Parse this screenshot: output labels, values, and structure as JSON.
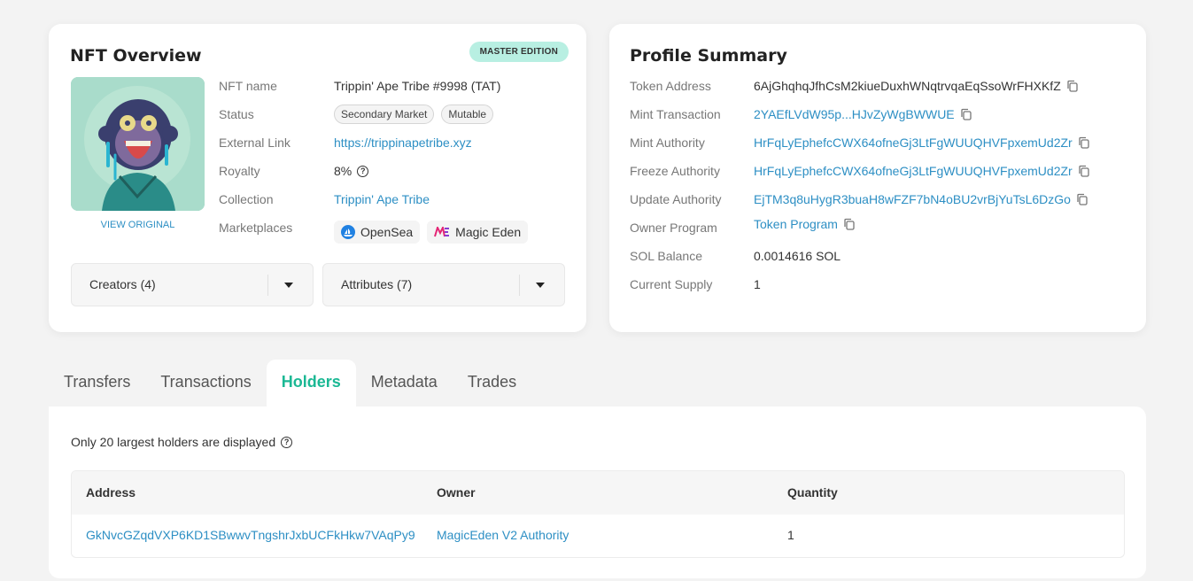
{
  "nft_overview": {
    "title": "NFT Overview",
    "badge": "MASTER EDITION",
    "view_original": "VIEW ORIGINAL",
    "fields": {
      "name_label": "NFT name",
      "name_value": "Trippin' Ape Tribe #9998 (TAT)",
      "status_label": "Status",
      "status_chips": [
        "Secondary Market",
        "Mutable"
      ],
      "external_link_label": "External Link",
      "external_link_value": "https://trippinapetribe.xyz",
      "royalty_label": "Royalty",
      "royalty_value": "8%",
      "collection_label": "Collection",
      "collection_value": "Trippin' Ape Tribe",
      "marketplaces_label": "Marketplaces",
      "marketplaces": [
        "OpenSea",
        "Magic Eden"
      ]
    },
    "creators_label": "Creators (4)",
    "attributes_label": "Attributes (7)"
  },
  "profile_summary": {
    "title": "Profile Summary",
    "rows": [
      {
        "label": "Token Address",
        "value": "6AjGhqhqJfhCsM2kiueDuxhWNqtrvqaEqSsoWrFHXKfZ"
      },
      {
        "label": "Mint Transaction",
        "value": "2YAEfLVdW95p...HJvZyWgBWWUE"
      },
      {
        "label": "Mint Authority",
        "value": "HrFqLyEphefcCWX64ofneGj3LtFgWUUQHVFpxemUd2Zr"
      },
      {
        "label": "Freeze Authority",
        "value": "HrFqLyEphefcCWX64ofneGj3LtFgWUUQHVFpxemUd2Zr"
      },
      {
        "label": "Update Authority",
        "value": "EjTM3q8uHygR3buaH8wFZF7bN4oBU2vrBjYuTsL6DzGo"
      },
      {
        "label": "Owner Program",
        "value": "Token Program"
      },
      {
        "label": "SOL Balance",
        "value": "0.0014616 SOL"
      },
      {
        "label": "Current Supply",
        "value": "1"
      }
    ]
  },
  "tabs": [
    "Transfers",
    "Transactions",
    "Holders",
    "Metadata",
    "Trades"
  ],
  "active_tab": "Holders",
  "holders": {
    "note": "Only 20 largest holders are displayed",
    "columns": [
      "Address",
      "Owner",
      "Quantity"
    ],
    "rows": [
      {
        "address": "GkNvcGZqdVXP6KD1SBwwvTngshrJxbUCFkHkw7VAqPy9",
        "owner": "MagicEden V2 Authority",
        "quantity": "1"
      }
    ]
  },
  "colors": {
    "accent": "#1bb894",
    "link": "#2d8fc4",
    "badge_bg": "#b8efe2",
    "page_bg": "#f3f3f3"
  },
  "icons": [
    "copy-icon",
    "help-icon",
    "opensea-icon",
    "magiceden-icon",
    "chevron-down-icon"
  ]
}
